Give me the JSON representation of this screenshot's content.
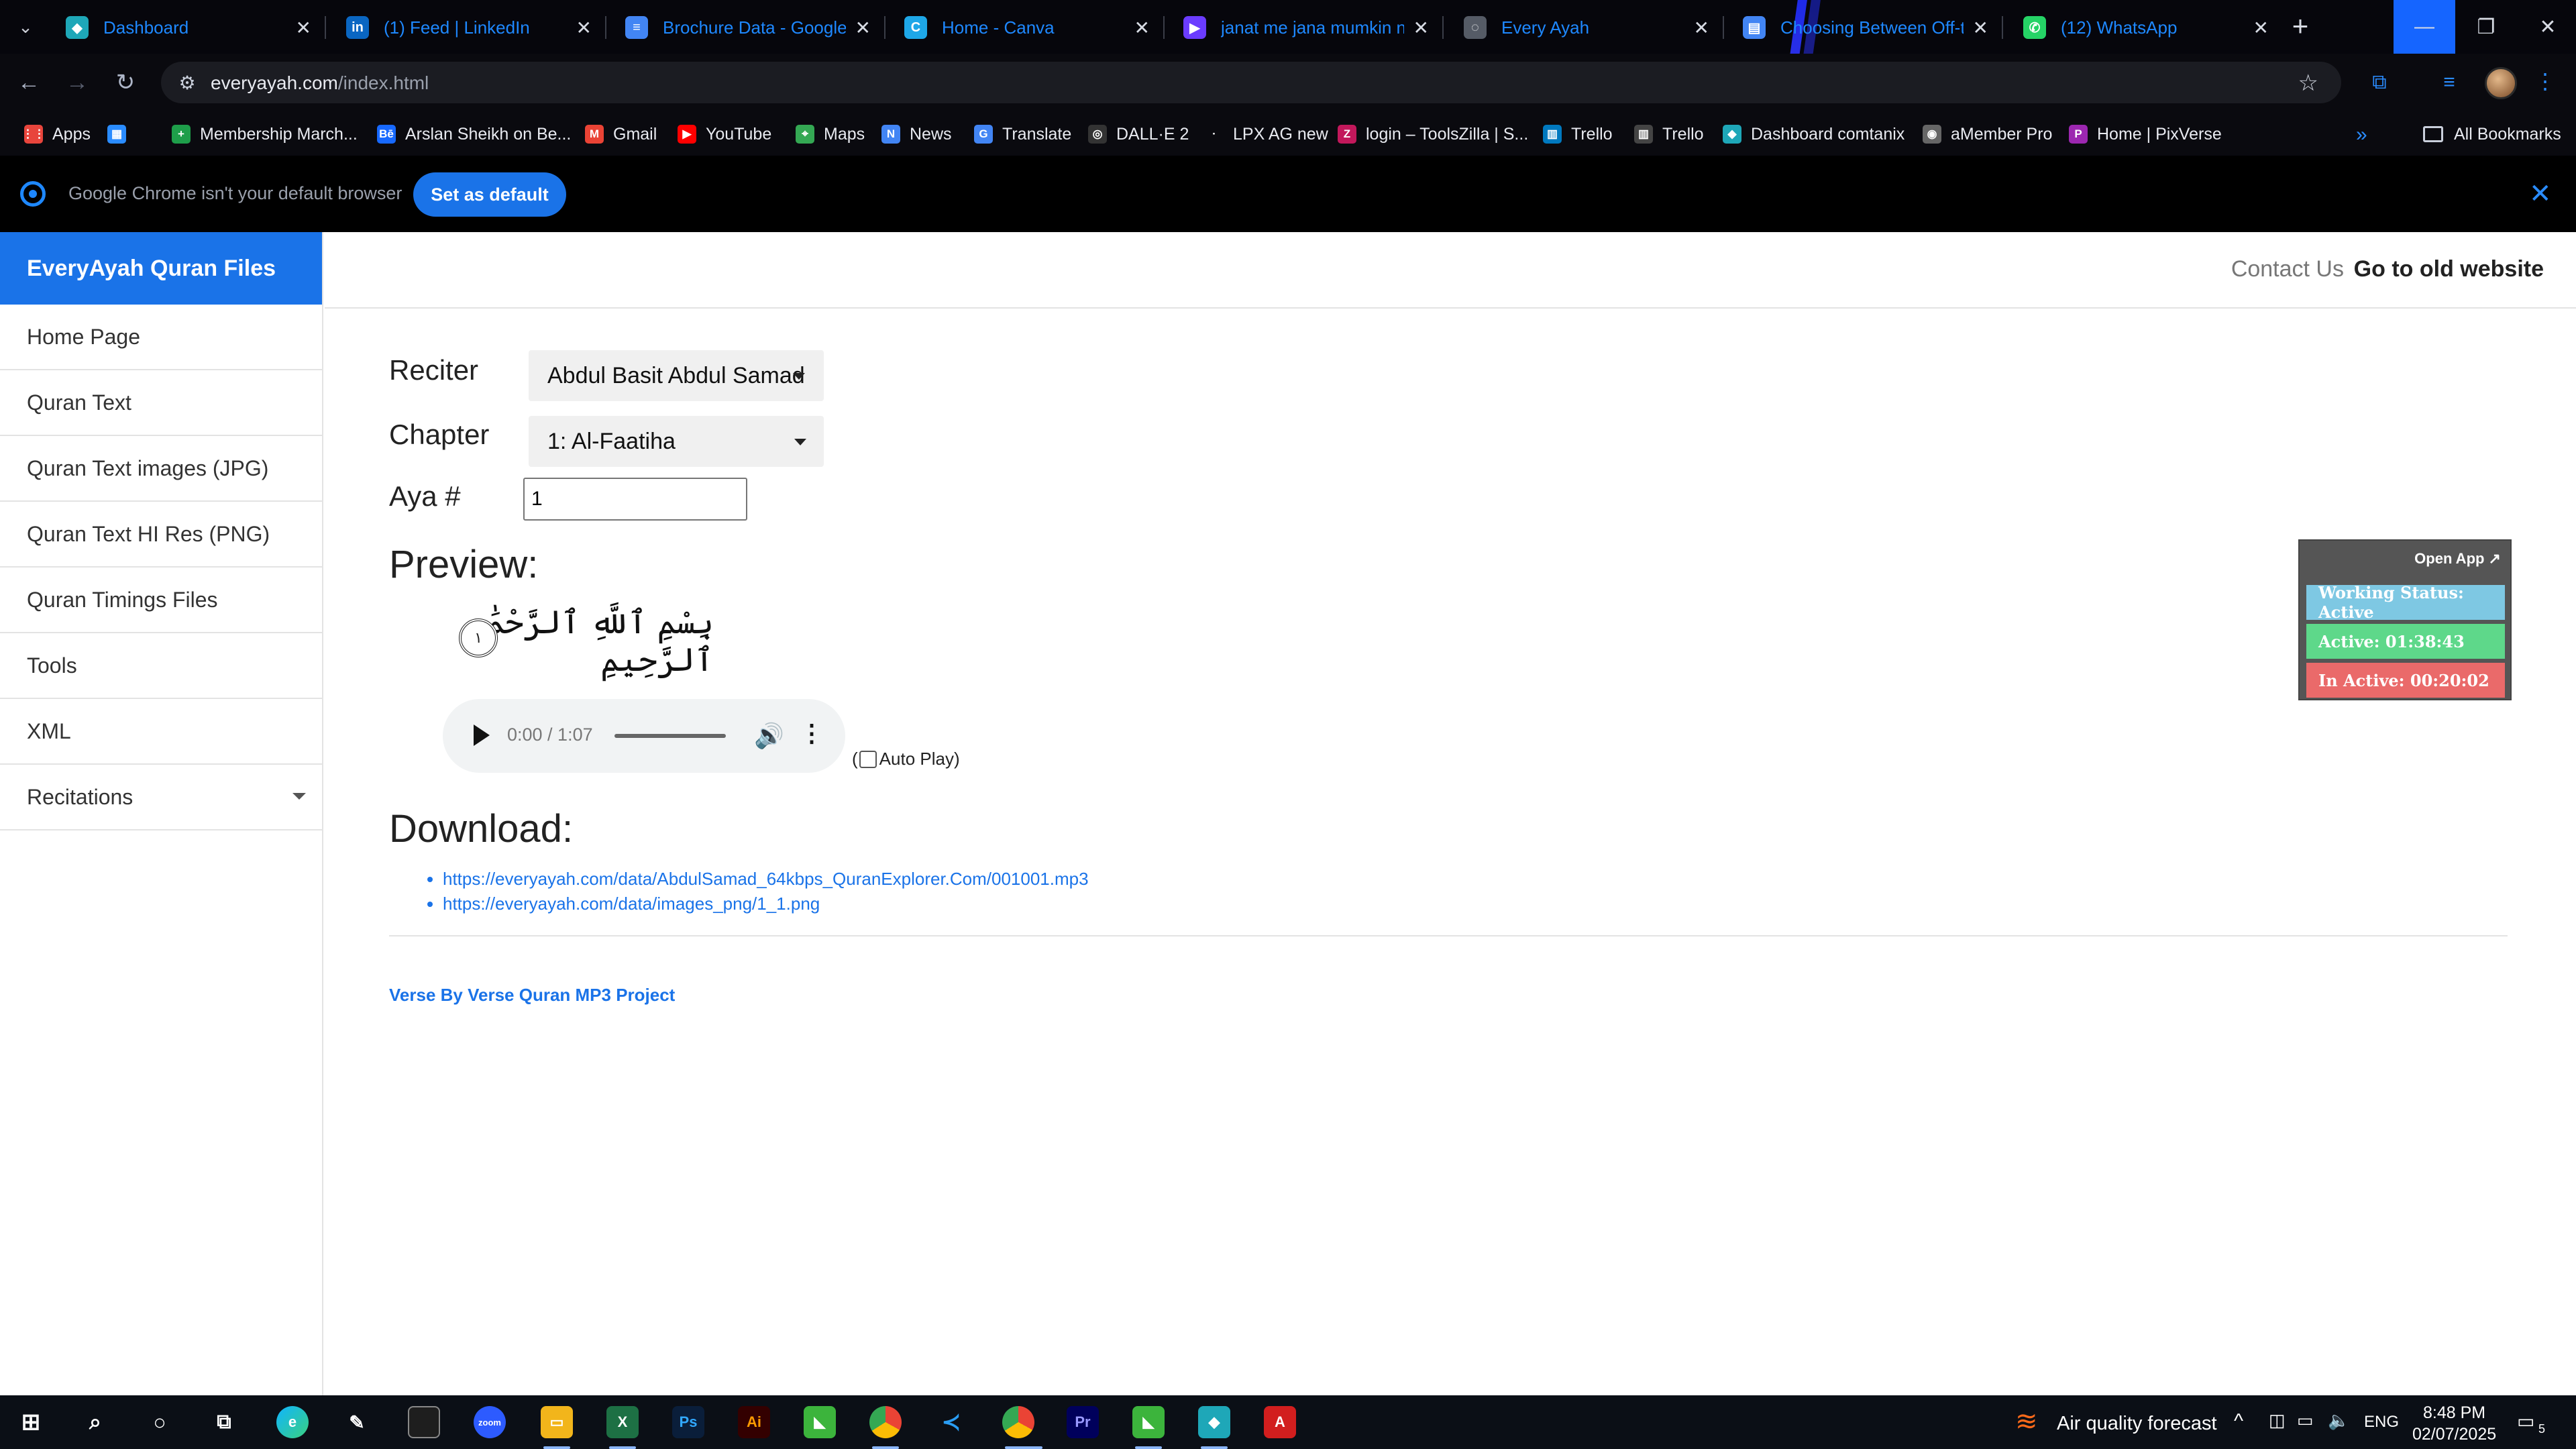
{
  "browser": {
    "tabs": [
      {
        "title": "Dashboard",
        "fav_color": "#1ea7b8",
        "fav_glyph": "◆"
      },
      {
        "title": "(1) Feed | LinkedIn",
        "fav_color": "#0a66c2",
        "fav_glyph": "in"
      },
      {
        "title": "Brochure Data - Google Docs",
        "fav_color": "#4285f4",
        "fav_glyph": "≡"
      },
      {
        "title": "Home - Canva",
        "fav_color": "#1ea7e8",
        "fav_glyph": "C"
      },
      {
        "title": "janat me jana mumkin nahi",
        "fav_color": "#6b3cff",
        "fav_glyph": "▶"
      },
      {
        "title": "Every Ayah",
        "fav_color": "#555b66",
        "fav_glyph": "◌"
      },
      {
        "title": "Choosing Between Off-the-Shelf",
        "fav_color": "#4285f4",
        "fav_glyph": "▤"
      },
      {
        "title": "(12) WhatsApp",
        "fav_color": "#25d366",
        "fav_glyph": "✆"
      }
    ],
    "url_domain": "everyayah.com",
    "url_path": "/index.html",
    "bookmarks": [
      {
        "label": "Apps",
        "color": "#e8453c",
        "glyph": "⋮⋮"
      },
      {
        "label": "",
        "color": "#2a8cff",
        "glyph": "▦"
      },
      {
        "label": "Membership March...",
        "color": "#1e9e4a",
        "glyph": "+"
      },
      {
        "label": "Arslan Sheikh on Be...",
        "color": "#1769ff",
        "glyph": "Bē"
      },
      {
        "label": "Gmail",
        "color": "#ea4335",
        "glyph": "M"
      },
      {
        "label": "YouTube",
        "color": "#ff0000",
        "glyph": "▶"
      },
      {
        "label": "Maps",
        "color": "#34a853",
        "glyph": "⌖"
      },
      {
        "label": "News",
        "color": "#4285f4",
        "glyph": "N"
      },
      {
        "label": "Translate",
        "color": "#4285f4",
        "glyph": "G"
      },
      {
        "label": "DALL·E 2",
        "color": "#333333",
        "glyph": "◎"
      },
      {
        "label": "LPX AG new",
        "color": "#0a0a0f",
        "glyph": "·"
      },
      {
        "label": "login – ToolsZilla | S...",
        "color": "#c2185b",
        "glyph": "Z"
      },
      {
        "label": "Trello",
        "color": "#0079bf",
        "glyph": "▥"
      },
      {
        "label": "Trello",
        "color": "#444444",
        "glyph": "▥"
      },
      {
        "label": "Dashboard comtanix",
        "color": "#1ea7b8",
        "glyph": "◆"
      },
      {
        "label": "aMember Pro",
        "color": "#666666",
        "glyph": "◉"
      },
      {
        "label": "Home | PixVerse",
        "color": "#9c27b0",
        "glyph": "P"
      }
    ],
    "all_bookmarks": "All Bookmarks",
    "infobar_message": "Google Chrome isn't your default browser",
    "infobar_button": "Set as default"
  },
  "site": {
    "brand": "EveryAyah Quran Files",
    "nav": [
      "Home Page",
      "Quran Text",
      "Quran Text images (JPG)",
      "Quran Text HI Res (PNG)",
      "Quran Timings Files",
      "Tools",
      "XML",
      "Recitations"
    ],
    "contact": "Contact Us",
    "old_site": "Go to old website",
    "form": {
      "reciter_label": "Reciter",
      "reciter_value": "Abdul Basit Abdul Samad",
      "chapter_label": "Chapter",
      "chapter_value": "1: Al-Faatiha",
      "aya_label": "Aya #",
      "aya_value": "1"
    },
    "preview_heading": "Preview:",
    "ayah_text": "بِسْمِ ٱللَّهِ ٱلرَّحْمَٰنِ ٱلرَّحِيمِ",
    "ayah_number": "١",
    "audio": {
      "time": "0:00 / 1:07"
    },
    "autoplay_label": "Auto Play)",
    "download_heading": "Download:",
    "download_links": [
      "https://everyayah.com/data/AbdulSamad_64kbps_QuranExplorer.Com/001001.mp3",
      "https://everyayah.com/data/images_png/1_1.png"
    ],
    "footer_link": "Verse By Verse Quran MP3 Project"
  },
  "widget": {
    "open_app": "Open App ↗",
    "working_status": "Working Status: Active",
    "active": "Active: 01:38:43",
    "inactive": "In Active: 00:20:02"
  },
  "taskbar": {
    "weather": "Air quality forecast",
    "lang": "ENG",
    "time": "8:48 PM",
    "date": "02/07/2025",
    "notifications": "5"
  }
}
